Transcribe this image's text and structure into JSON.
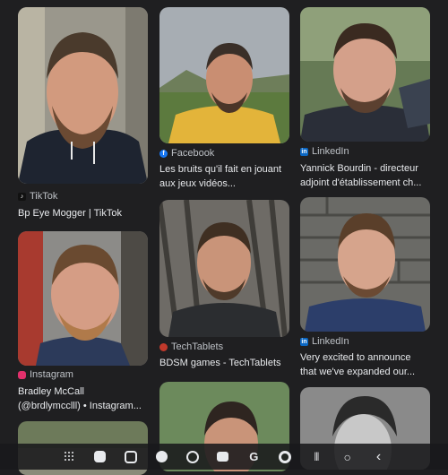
{
  "results": [
    {
      "source": "",
      "caption_line1": "",
      "caption_line2": ""
    },
    {
      "source": "Facebook",
      "caption_line1": "Les bruits qu'il fait en jouant",
      "caption_line2": "aux jeux vidéos..."
    },
    {
      "source": "LinkedIn",
      "caption_line1": "Yannick Bourdin - directeur",
      "caption_line2": "adjoint d'établissement ch..."
    },
    {
      "source": "TikTok",
      "caption_line1": "Bp Eye Mogger | TikTok",
      "caption_line2": ""
    },
    {
      "source": "Instagram",
      "caption_line1": "Bradley McCall",
      "caption_line2": "(@brdlymcclll) • Instagram..."
    },
    {
      "source": "TechTablets",
      "caption_line1": "BDSM games - TechTablets",
      "caption_line2": ""
    },
    {
      "source": "LinkedIn",
      "caption_line1": "Very excited to announce",
      "caption_line2": "that we've expanded our..."
    }
  ],
  "nav": {
    "icons": [
      "apps-grid-icon",
      "app-icon-1",
      "app-icon-2",
      "messages-icon",
      "compass-icon",
      "camera-icon",
      "google-icon",
      "chrome-icon"
    ],
    "system": [
      "recents-icon",
      "home-icon",
      "back-icon"
    ],
    "google_letter": "G",
    "recents_glyph": "|||",
    "home_glyph": "○",
    "back_glyph": "‹"
  },
  "colors": {
    "background": "#1f1f21",
    "facebook": "#1877f2",
    "linkedin": "#0a66c2",
    "instagram": "#e1306c",
    "tiktok": "#111111",
    "techtablets": "#c0392b"
  }
}
